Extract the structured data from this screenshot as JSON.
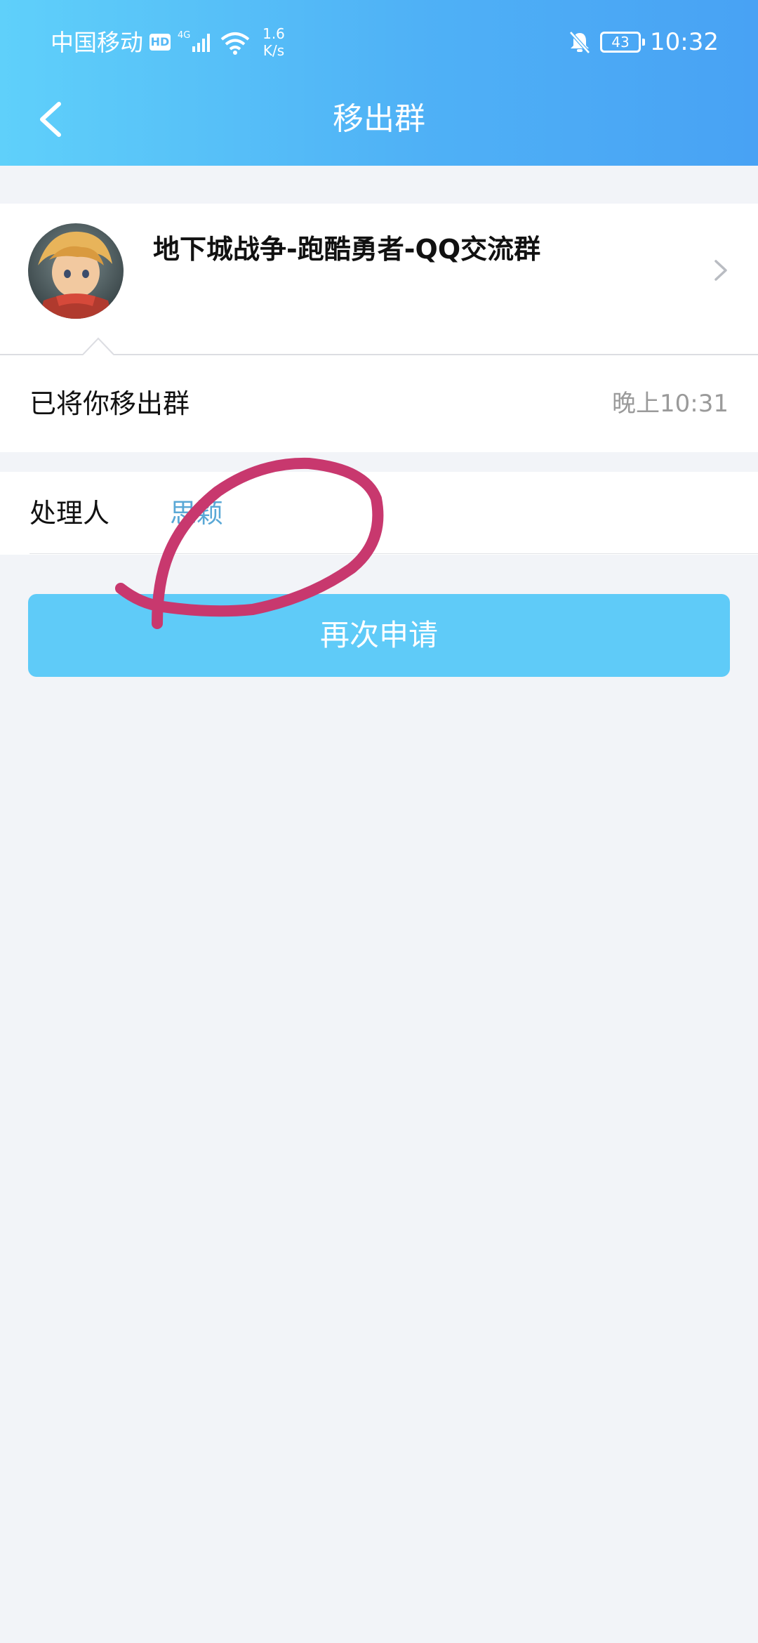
{
  "status_bar": {
    "carrier": "中国移动",
    "hd_badge": "HD",
    "network_type": "4G",
    "speed_value": "1.6",
    "speed_unit": "K/s",
    "battery": "43",
    "time": "10:32"
  },
  "nav": {
    "title": "移出群"
  },
  "group": {
    "name": "地下城战争-跑酷勇者-QQ交流群"
  },
  "message": {
    "text": "已将你移出群",
    "time": "晚上10:31"
  },
  "handler": {
    "label": "处理人",
    "name": "思颖"
  },
  "actions": {
    "reapply_label": "再次申请"
  },
  "colors": {
    "header_gradient_start": "#5fd0fa",
    "header_gradient_end": "#48a2f4",
    "button": "#5fcbf8",
    "link": "#5aa8d6",
    "annotation": "#c8386e"
  }
}
